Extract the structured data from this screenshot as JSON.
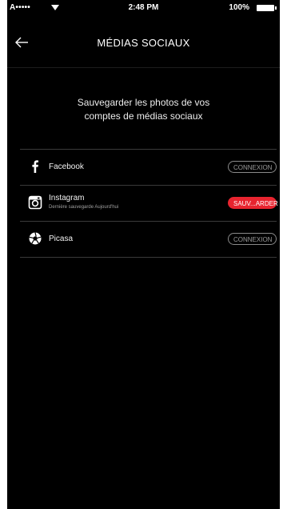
{
  "status_bar": {
    "carrier": "A•••••",
    "time": "2:48 PM",
    "battery": "100%"
  },
  "header": {
    "title": "MÉDIAS SOCIAUX",
    "back_icon": "arrow-left-icon"
  },
  "intro": {
    "line1": "Sauvegarder les photos de vos",
    "line2": "comptes de médias sociaux"
  },
  "accounts": [
    {
      "name": "Facebook",
      "subtitle": "",
      "action": "CONNEXION",
      "icon": "facebook-icon"
    },
    {
      "name": "Instagram",
      "subtitle": "Dernière sauvegarde Aujourd'hui",
      "action": "SAUV...ARDER",
      "icon": "instagram-icon"
    },
    {
      "name": "Picasa",
      "subtitle": "",
      "action": "CONNEXION",
      "icon": "picasa-icon"
    }
  ],
  "colors": {
    "background": "#000000",
    "accent": "#e8242f",
    "divider": "#3a3a3a"
  }
}
